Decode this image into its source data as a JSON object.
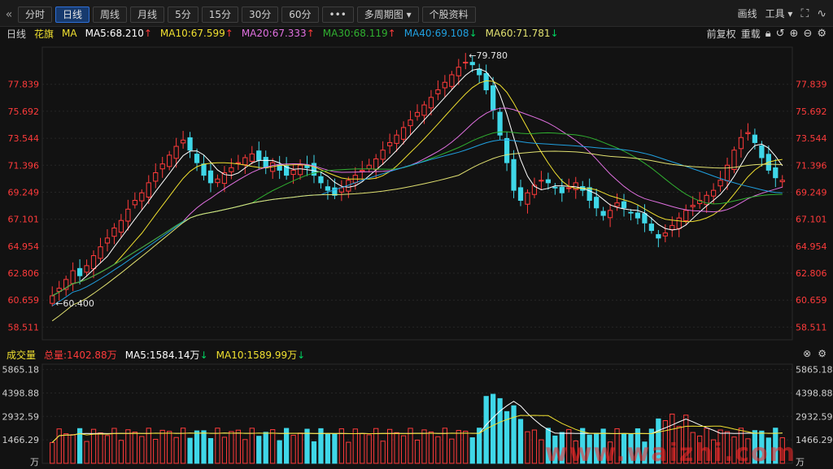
{
  "toolbar": {
    "back_icon": "chevron-double-left-icon",
    "periods": [
      "分时",
      "日线",
      "周线",
      "月线",
      "5分",
      "15分",
      "30分",
      "60分"
    ],
    "active_period": "日线",
    "more": "•••",
    "multi_period": "多周期图",
    "stock_info": "个股资料",
    "draw_line": "画线",
    "tools": "工具",
    "close_icon": "close-icon",
    "fullscreen_icon": "fullscreen-icon",
    "wave_icon": "wave-icon"
  },
  "ma_bar": {
    "period": "日线",
    "name": "花旗",
    "indicator": "MA",
    "items": [
      {
        "label": "MA5:68.210",
        "arrow": "↑",
        "color": "#ffffff",
        "dir": "up"
      },
      {
        "label": "MA10:67.599",
        "arrow": "↑",
        "color": "#f0e030",
        "dir": "up"
      },
      {
        "label": "MA20:67.333",
        "arrow": "↑",
        "color": "#e070e0",
        "dir": "up"
      },
      {
        "label": "MA30:68.119",
        "arrow": "↑",
        "color": "#30b030",
        "dir": "up"
      },
      {
        "label": "MA40:69.108",
        "arrow": "↓",
        "color": "#20a0e0",
        "dir": "down"
      },
      {
        "label": "MA60:71.781",
        "arrow": "↓",
        "color": "#e0e070",
        "dir": "down"
      }
    ],
    "adjust": "前复权",
    "reload": "重载"
  },
  "price_axis": [
    "77.839",
    "75.692",
    "73.544",
    "71.396",
    "69.249",
    "67.101",
    "64.954",
    "62.806",
    "60.659",
    "58.511"
  ],
  "high_label": "79.780",
  "low_label": "60.400",
  "volume_bar": {
    "label": "成交量",
    "total": "总量:1402.88万",
    "ma5": "MA5:1584.14万",
    "ma10": "MA10:1589.99万"
  },
  "volume_axis": [
    "5865.18",
    "4398.88",
    "2932.59",
    "1466.29",
    "万"
  ],
  "watermark": "www.waizhi.com",
  "colors": {
    "up": "#ff3b3b",
    "down": "#3fd7e8",
    "bg": "#121212",
    "grid": "#2a2a2a"
  },
  "chart_data": {
    "type": "candlestick",
    "title": "",
    "ylim": [
      57.5,
      80.8
    ],
    "closes": [
      61.0,
      61.6,
      62.3,
      63.0,
      62.6,
      63.4,
      64.2,
      64.9,
      65.6,
      66.4,
      67.0,
      67.9,
      68.6,
      69.2,
      70.0,
      70.8,
      71.5,
      72.2,
      72.9,
      73.4,
      72.6,
      71.6,
      70.6,
      70.0,
      70.3,
      70.8,
      71.2,
      71.6,
      72.0,
      72.3,
      71.8,
      71.2,
      71.6,
      71.0,
      70.6,
      71.0,
      71.4,
      71.2,
      70.6,
      70.0,
      69.4,
      69.0,
      69.6,
      70.2,
      70.6,
      71.0,
      71.4,
      71.9,
      72.6,
      73.2,
      73.8,
      74.4,
      75.0,
      75.6,
      76.2,
      76.8,
      77.4,
      78.0,
      78.6,
      79.2,
      79.6,
      79.4,
      78.6,
      77.4,
      75.8,
      73.8,
      71.6,
      69.4,
      68.6,
      69.2,
      69.8,
      70.2,
      70.0,
      69.6,
      69.2,
      69.6,
      70.0,
      69.4,
      68.6,
      68.0,
      67.4,
      67.8,
      68.4,
      68.0,
      67.6,
      67.2,
      66.8,
      66.2,
      65.6,
      66.0,
      66.6,
      67.2,
      67.8,
      68.2,
      68.6,
      69.0,
      69.4,
      70.2,
      71.4,
      72.6,
      73.6,
      74.0,
      73.2,
      72.0,
      71.0,
      70.4,
      70.2
    ]
  }
}
